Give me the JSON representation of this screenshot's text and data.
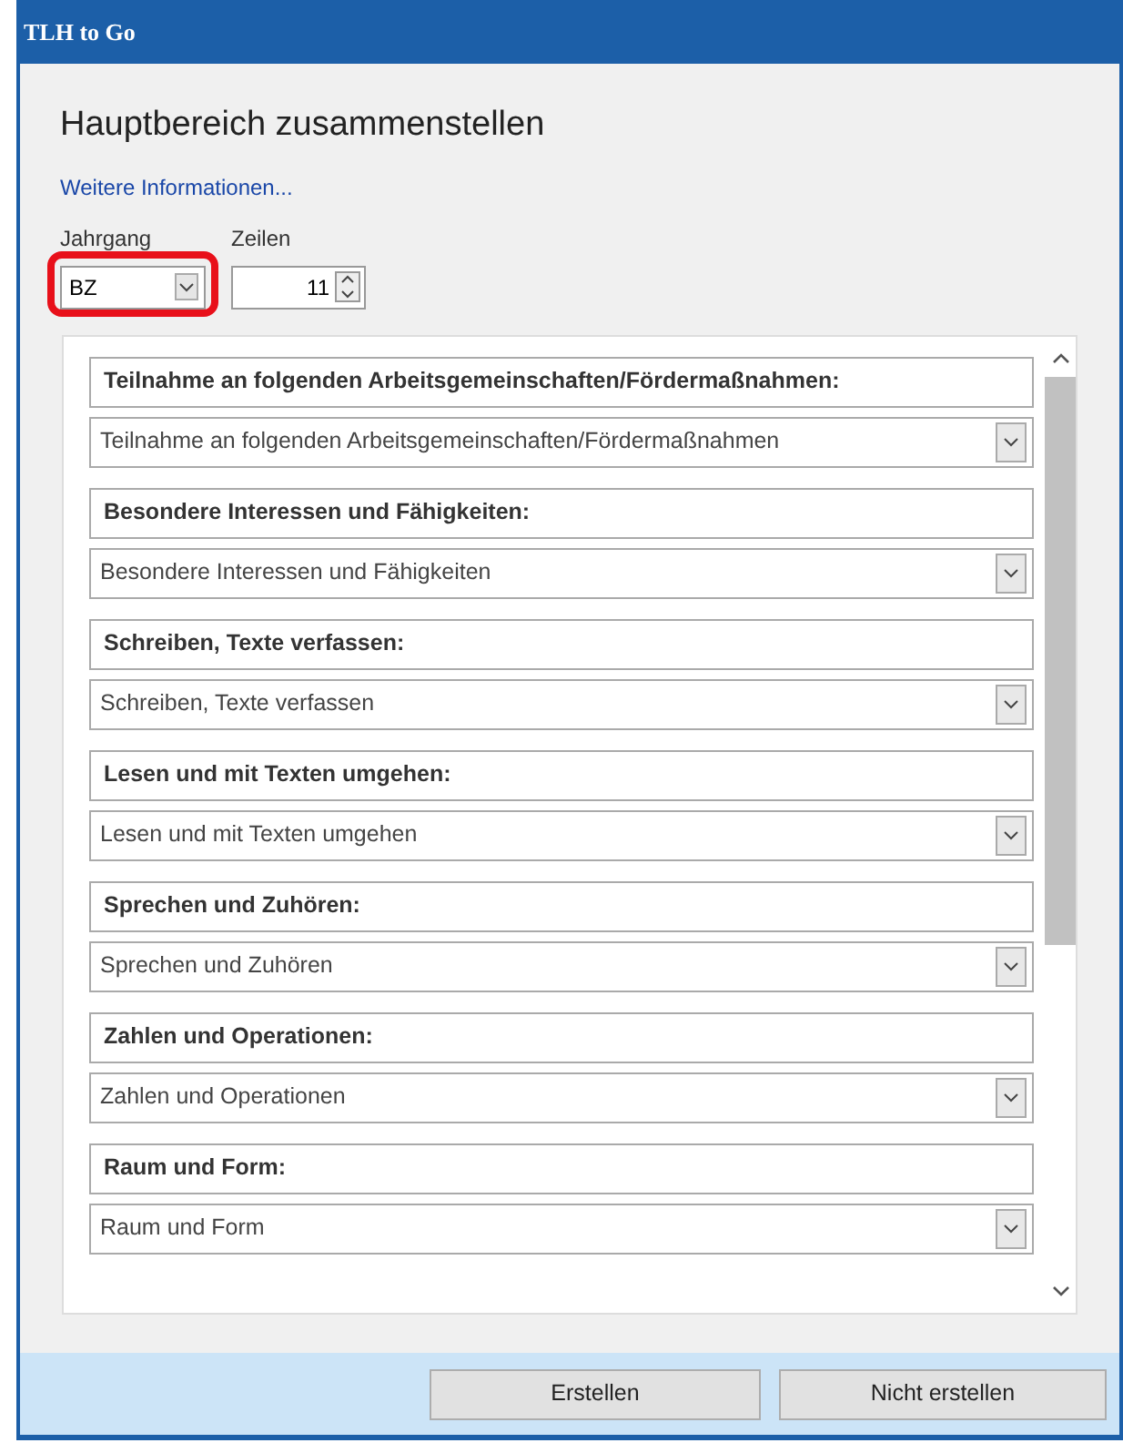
{
  "window": {
    "title": "TLH to Go"
  },
  "heading": "Hauptbereich zusammenstellen",
  "link": "Weitere Informationen...",
  "jahrgang": {
    "label": "Jahrgang",
    "value": "BZ",
    "highlighted": true
  },
  "zeilen": {
    "label": "Zeilen",
    "value": "11"
  },
  "sections": [
    {
      "title": "Teilnahme an folgenden Arbeitsgemeinschaften/Fördermaßnahmen:",
      "value": "Teilnahme an folgenden Arbeitsgemeinschaften/Fördermaßnahmen"
    },
    {
      "title": "Besondere Interessen und Fähigkeiten:",
      "value": "Besondere Interessen und Fähigkeiten"
    },
    {
      "title": "Schreiben, Texte verfassen:",
      "value": "Schreiben, Texte verfassen"
    },
    {
      "title": "Lesen und mit Texten umgehen:",
      "value": "Lesen und mit Texten umgehen"
    },
    {
      "title": "Sprechen und Zuhören:",
      "value": "Sprechen und Zuhören"
    },
    {
      "title": "Zahlen und Operationen:",
      "value": "Zahlen und Operationen"
    },
    {
      "title": "Raum und Form:",
      "value": "Raum und Form"
    }
  ],
  "buttons": [
    "Erstellen",
    "Nicht erstellen"
  ]
}
